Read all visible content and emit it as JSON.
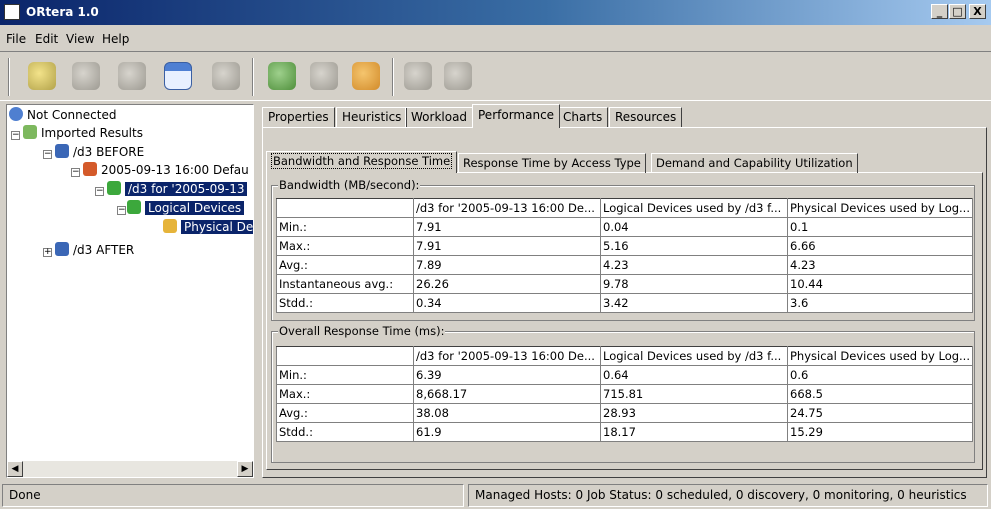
{
  "window": {
    "title": "ORtera 1.0",
    "minimize": "_",
    "maximize": "□",
    "close": "X"
  },
  "menu": [
    "File",
    "Edit",
    "View",
    "Help"
  ],
  "toolbar": {
    "icons": [
      "connect-icon",
      "disconnect-icon",
      "search-icon",
      "new-window-icon",
      "refresh-icon",
      "download-icon",
      "import-icon",
      "export-icon",
      "delete-icon",
      "cut-icon"
    ]
  },
  "tree": {
    "root": "Not Connected",
    "imported": "Imported Results",
    "before": "/d3 BEFORE",
    "run": "2005-09-13 16:00 Defau",
    "d3for": "/d3 for '2005-09-13",
    "logical": "Logical Devices",
    "physical": "Physical Dev",
    "after": "/d3 AFTER"
  },
  "tabs": [
    "Properties",
    "Heuristics",
    "Workload",
    "Performance",
    "Charts",
    "Resources"
  ],
  "active_tab": "Performance",
  "subtabs": [
    "Bandwidth and Response Time",
    "Response Time by Access Type",
    "Demand and Capability Utilization"
  ],
  "bandwidth": {
    "title": "Bandwidth (MB/second):",
    "headers": [
      "",
      "/d3 for '2005-09-13 16:00 De...",
      "Logical Devices used by /d3 f...",
      "Physical Devices used by Log..."
    ],
    "rows": [
      [
        "Min.:",
        "7.91",
        "0.04",
        "0.1"
      ],
      [
        "Max.:",
        "7.91",
        "5.16",
        "6.66"
      ],
      [
        "Avg.:",
        "7.89",
        "4.23",
        "4.23"
      ],
      [
        "Instantaneous avg.:",
        "26.26",
        "9.78",
        "10.44"
      ],
      [
        "Stdd.:",
        "0.34",
        "3.42",
        "3.6"
      ]
    ]
  },
  "response": {
    "title": "Overall Response Time (ms):",
    "headers": [
      "",
      "/d3 for '2005-09-13 16:00 De...",
      "Logical Devices used by /d3 f...",
      "Physical Devices used by Log..."
    ],
    "rows": [
      [
        "Min.:",
        "6.39",
        "0.64",
        "0.6"
      ],
      [
        "Max.:",
        "8,668.17",
        "715.81",
        "668.5"
      ],
      [
        "Avg.:",
        "38.08",
        "28.93",
        "24.75"
      ],
      [
        "Stdd.:",
        "61.9",
        "18.17",
        "15.29"
      ]
    ]
  },
  "status": {
    "left": "Done",
    "right": "Managed Hosts: 0 Job Status: 0 scheduled, 0 discovery, 0 monitoring, 0 heuristics"
  }
}
